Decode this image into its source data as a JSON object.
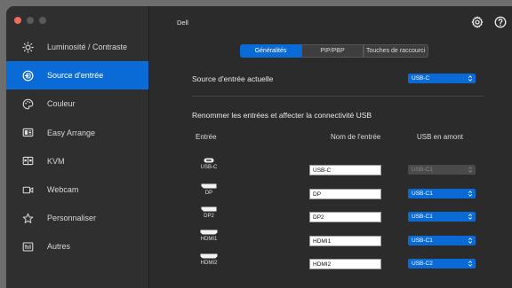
{
  "app": {
    "title": "Dell"
  },
  "sidebar": {
    "items": [
      {
        "label": "Luminosité / Contraste",
        "icon": "sun-icon"
      },
      {
        "label": "Source d'entrée",
        "icon": "input-source-icon"
      },
      {
        "label": "Couleur",
        "icon": "color-palette-icon"
      },
      {
        "label": "Easy Arrange",
        "icon": "layout-icon"
      },
      {
        "label": "KVM",
        "icon": "kvm-icon"
      },
      {
        "label": "Webcam",
        "icon": "webcam-icon"
      },
      {
        "label": "Personnaliser",
        "icon": "star-icon"
      },
      {
        "label": "Autres",
        "icon": "others-icon"
      }
    ],
    "active_index": 1
  },
  "tabs": [
    "Généralités",
    "PIP/PBP",
    "Touches de raccourci"
  ],
  "current_source": {
    "label": "Source d'entrée actuelle",
    "value": "USB-C"
  },
  "rename_section": {
    "title": "Renommer les entrées et affecter la connectivité USB",
    "headers": {
      "input": "Entrée",
      "name": "Nom de l'entrée",
      "usb": "USB en amont"
    },
    "rows": [
      {
        "port": "USB-C",
        "name": "USB-C",
        "usb": "USB-C1",
        "disabled": true
      },
      {
        "port": "DP",
        "name": "DP",
        "usb": "USB-C1",
        "disabled": false
      },
      {
        "port": "DP2",
        "name": "DP2",
        "usb": "USB-C1",
        "disabled": false
      },
      {
        "port": "HDMI1",
        "name": "HDMI1",
        "usb": "USB-C1",
        "disabled": false
      },
      {
        "port": "HDMI2",
        "name": "HDMI2",
        "usb": "USB-C2",
        "disabled": false
      }
    ]
  },
  "colors": {
    "accent": "#0b6bd6",
    "background": "#2b2b2b",
    "sidebar": "#2f2f2f"
  }
}
